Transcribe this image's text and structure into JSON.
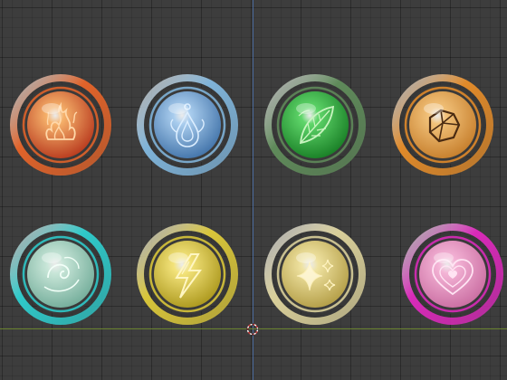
{
  "viewport": {
    "background_color": "#3d3d3d",
    "y_axis_color": "#4a6fa8",
    "x_axis_color": "#6f8a2e"
  },
  "badges": [
    {
      "name": "fire-element-badge",
      "icon": "flame-icon",
      "ring_color": "#e0632a",
      "core_light": "#f6b26b",
      "core_dark": "#b5341a"
    },
    {
      "name": "water-element-badge",
      "icon": "water-drop-icon",
      "ring_color": "#7fb3d8",
      "core_light": "#a9cdee",
      "core_dark": "#3d6fa6"
    },
    {
      "name": "nature-element-badge",
      "icon": "leaf-icon",
      "ring_color": "#5f8a5a",
      "core_light": "#5fd66a",
      "core_dark": "#157a22"
    },
    {
      "name": "earth-element-badge",
      "icon": "rock-icon",
      "ring_color": "#e08a2a",
      "core_light": "#f2c27a",
      "core_dark": "#c47b28"
    },
    {
      "name": "wind-element-badge",
      "icon": "wind-swirl-icon",
      "ring_color": "#2fc9c9",
      "core_light": "#c8e6d8",
      "core_dark": "#6faa97"
    },
    {
      "name": "lightning-element-badge",
      "icon": "lightning-bolt-icon",
      "ring_color": "#d8c53a",
      "core_light": "#f3e37a",
      "core_dark": "#a89418"
    },
    {
      "name": "light-element-badge",
      "icon": "sparkle-stars-icon",
      "ring_color": "#d9cf9a",
      "core_light": "#efe2a0",
      "core_dark": "#b09a42"
    },
    {
      "name": "love-element-badge",
      "icon": "heart-icon",
      "ring_color": "#d92ab9",
      "core_light": "#f4b4d6",
      "core_dark": "#c86a9f"
    }
  ]
}
